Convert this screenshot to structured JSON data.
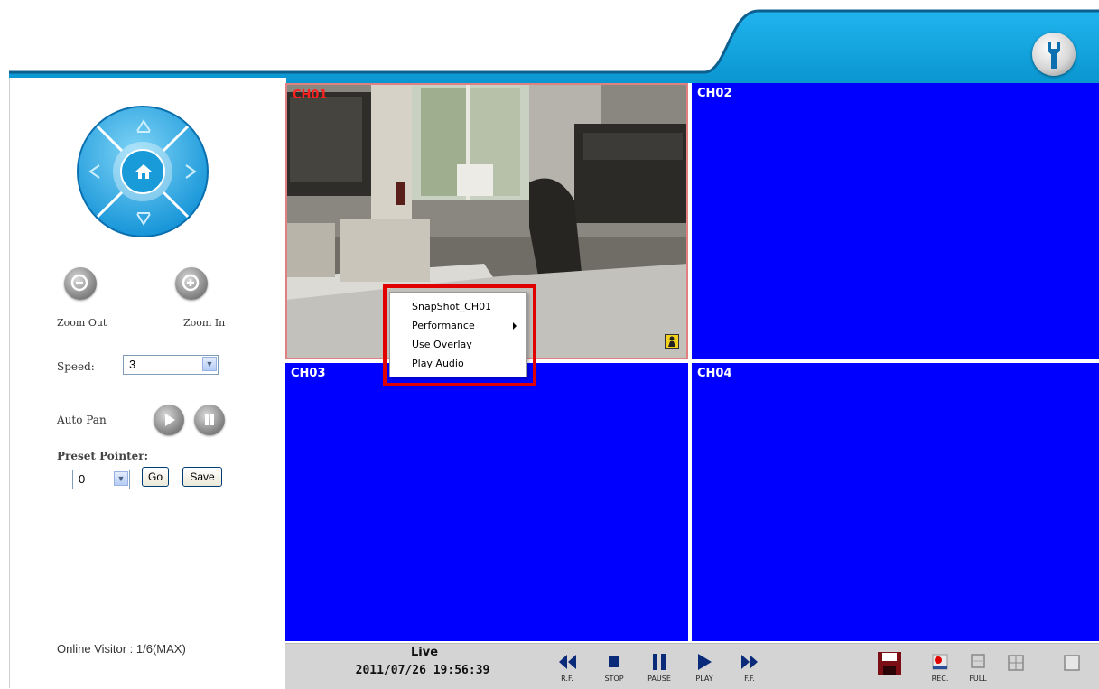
{
  "channels": [
    {
      "label": "CH01"
    },
    {
      "label": "CH02"
    },
    {
      "label": "CH03"
    },
    {
      "label": "CH04"
    }
  ],
  "context_menu": {
    "items": [
      "SnapShot_CH01",
      "Performance",
      "Use Overlay",
      "Play Audio"
    ]
  },
  "ptz": {
    "zoom_out": "Zoom Out",
    "zoom_in": "Zoom In",
    "speed_label": "Speed:",
    "speed_value": "3",
    "auto_pan": "Auto Pan",
    "preset_label": "Preset Pointer:",
    "preset_value": "0",
    "go": "Go",
    "save": "Save"
  },
  "status": {
    "visitors": "Online Visitor : 1/6(MAX)",
    "mode": "Live",
    "datetime": "2011/07/26 19:56:39"
  },
  "controls": {
    "rf": "R.F.",
    "stop": "STOP",
    "pause": "PAUSE",
    "play": "PLAY",
    "ff": "F.F.",
    "rec": "REC.",
    "full": "FULL"
  },
  "colors": {
    "accent": "#0aa0dc",
    "tile_blue": "#0000ff",
    "highlight": "#e00000"
  }
}
